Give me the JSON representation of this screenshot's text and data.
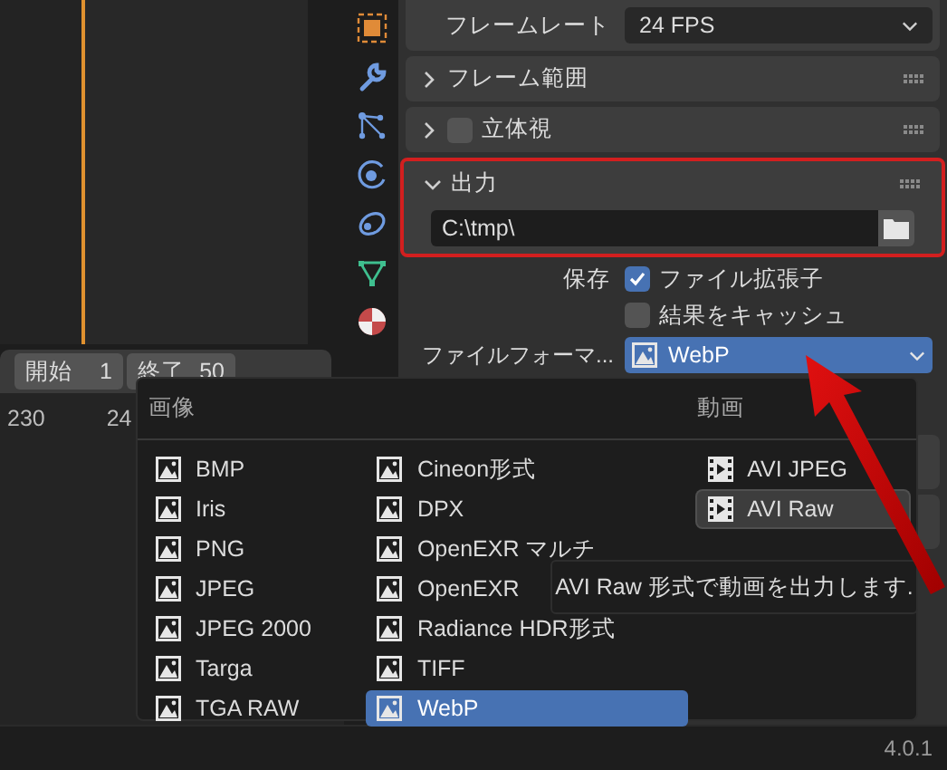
{
  "timeline": {
    "fields": [
      {
        "label": "開始",
        "value": "1"
      },
      {
        "label": "終了",
        "value": "50"
      }
    ],
    "ruler": [
      "230",
      "24"
    ]
  },
  "properties": {
    "frame_rate": {
      "label": "フレームレート",
      "value": "24 FPS"
    },
    "panels": [
      {
        "title": "フレーム範囲",
        "expanded": false
      },
      {
        "title": "立体視",
        "expanded": false,
        "checked": false
      },
      {
        "title": "出力",
        "expanded": true,
        "highlighted": true,
        "path": "C:\\tmp\\"
      }
    ],
    "save_label": "保存",
    "save_options": [
      {
        "label": "ファイル拡張子",
        "checked": true
      },
      {
        "label": "結果をキャッシュ",
        "checked": false
      }
    ],
    "file_format": {
      "label": "ファイルフォーマ...",
      "value": "WebP"
    }
  },
  "menu": {
    "columns": [
      {
        "heading": "画像",
        "kind": "image",
        "items": [
          {
            "label": "BMP",
            "selected": false,
            "hovered": false
          },
          {
            "label": "Iris",
            "selected": false,
            "hovered": false
          },
          {
            "label": "PNG",
            "selected": false,
            "hovered": false
          },
          {
            "label": "JPEG",
            "selected": false,
            "hovered": false
          },
          {
            "label": "JPEG 2000",
            "selected": false,
            "hovered": false
          },
          {
            "label": "Targa",
            "selected": false,
            "hovered": false
          },
          {
            "label": "TGA RAW",
            "selected": false,
            "hovered": false
          }
        ]
      },
      {
        "kind": "image",
        "items": [
          {
            "label": "Cineon形式",
            "selected": false,
            "hovered": false
          },
          {
            "label": "DPX",
            "selected": false,
            "hovered": false
          },
          {
            "label": "OpenEXR マルチ",
            "selected": false,
            "hovered": false
          },
          {
            "label": "OpenEXR",
            "selected": false,
            "hovered": false
          },
          {
            "label": "Radiance HDR形式",
            "selected": false,
            "hovered": false
          },
          {
            "label": "TIFF",
            "selected": false,
            "hovered": false
          },
          {
            "label": "WebP",
            "selected": true,
            "hovered": false
          }
        ]
      },
      {
        "heading": "動画",
        "kind": "movie",
        "items": [
          {
            "label": "AVI JPEG",
            "selected": false,
            "hovered": false
          },
          {
            "label": "AVI Raw",
            "selected": false,
            "hovered": true
          }
        ]
      }
    ],
    "tooltip": "AVI Raw 形式で動画を出力します."
  },
  "status_bar": {
    "version": "4.0.1"
  }
}
